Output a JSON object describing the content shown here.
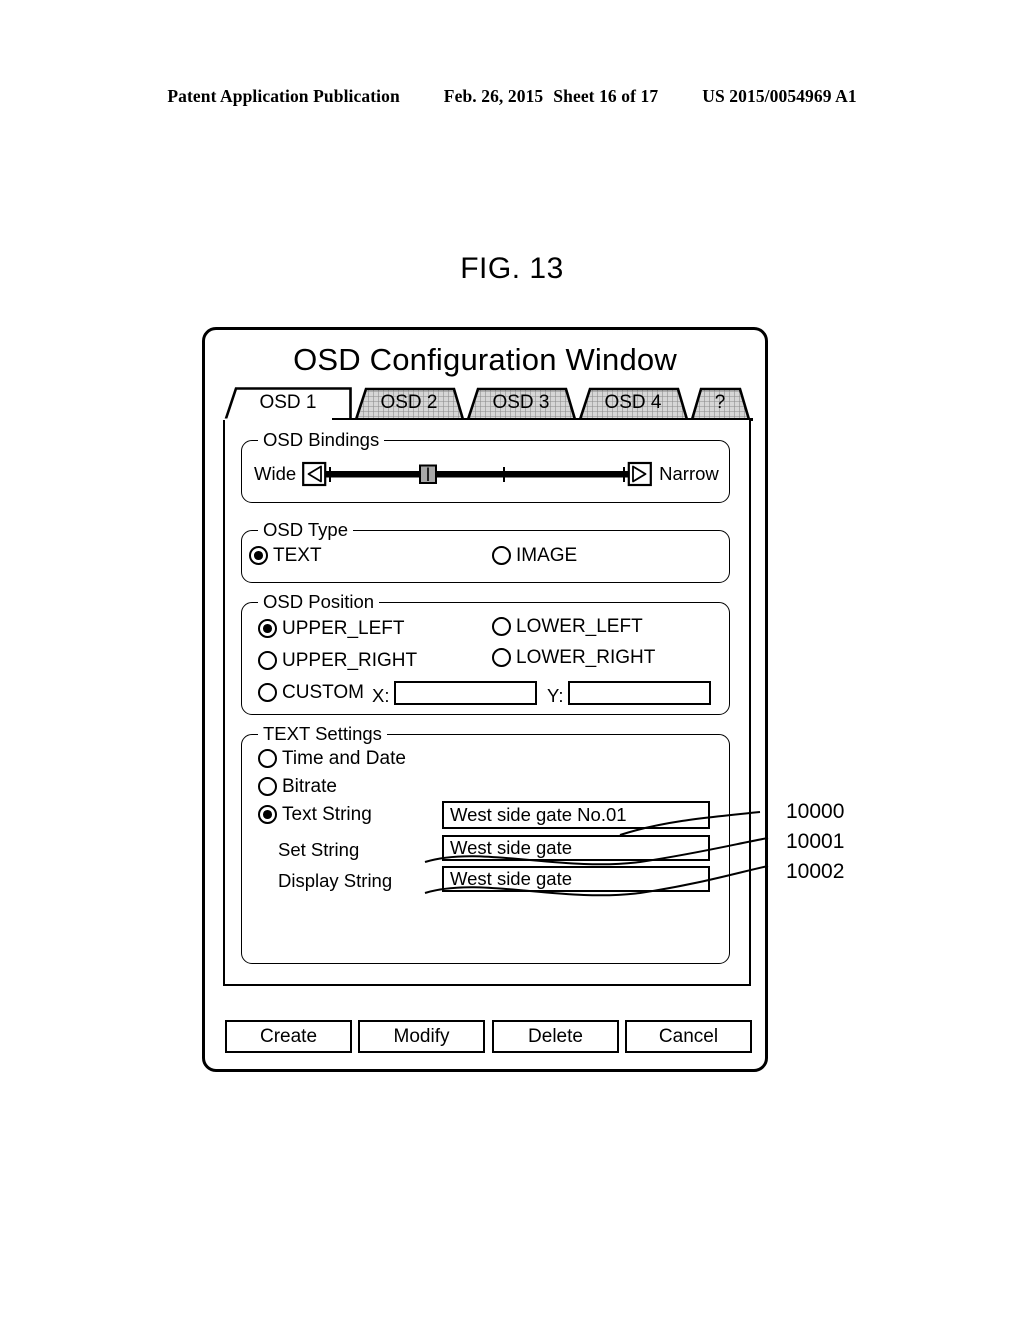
{
  "patent_header": {
    "publication": "Patent Application Publication",
    "date": "Feb. 26, 2015",
    "sheet": "Sheet 16 of 17",
    "number": "US 2015/0054969 A1"
  },
  "figure": {
    "label": "FIG. 13"
  },
  "dialog": {
    "title": "OSD Configuration Window",
    "tabs": [
      {
        "label": "OSD 1",
        "active": true
      },
      {
        "label": "OSD 2",
        "active": false
      },
      {
        "label": "OSD 3",
        "active": false
      },
      {
        "label": "OSD 4",
        "active": false
      },
      {
        "label": "?",
        "active": false
      }
    ],
    "osd_bindings": {
      "title": "OSD Bindings",
      "left_label": "Wide",
      "right_label": "Narrow",
      "slider_position_percent": 33
    },
    "osd_type": {
      "title": "OSD Type",
      "options": [
        {
          "label": "TEXT",
          "selected": true
        },
        {
          "label": "IMAGE",
          "selected": false
        }
      ]
    },
    "osd_position": {
      "title": "OSD Position",
      "options": [
        {
          "label": "UPPER_LEFT",
          "selected": true
        },
        {
          "label": "UPPER_RIGHT",
          "selected": false
        },
        {
          "label": "CUSTOM",
          "selected": false
        },
        {
          "label": "LOWER_LEFT",
          "selected": false
        },
        {
          "label": "LOWER_RIGHT",
          "selected": false
        }
      ],
      "x_label": "X:",
      "x_value": "",
      "y_label": "Y:",
      "y_value": ""
    },
    "text_settings": {
      "title": "TEXT Settings",
      "options": [
        {
          "label": "Time and Date",
          "selected": false
        },
        {
          "label": "Bitrate",
          "selected": false
        },
        {
          "label": "Text String",
          "selected": true
        }
      ],
      "text_string_value": "West side gate No.01",
      "set_string_label": "Set String",
      "set_string_value": "West side gate",
      "display_string_label": "Display String",
      "display_string_value": "West side gate"
    },
    "buttons": [
      {
        "label": "Create"
      },
      {
        "label": "Modify"
      },
      {
        "label": "Delete"
      },
      {
        "label": "Cancel"
      }
    ]
  },
  "callouts": [
    {
      "number": "10000"
    },
    {
      "number": "10001"
    },
    {
      "number": "10002"
    }
  ],
  "colors": {
    "line": "#000000",
    "background": "#ffffff",
    "inactive_tab": "#c9c9c9",
    "slider_thumb": "#a8a8a8"
  }
}
